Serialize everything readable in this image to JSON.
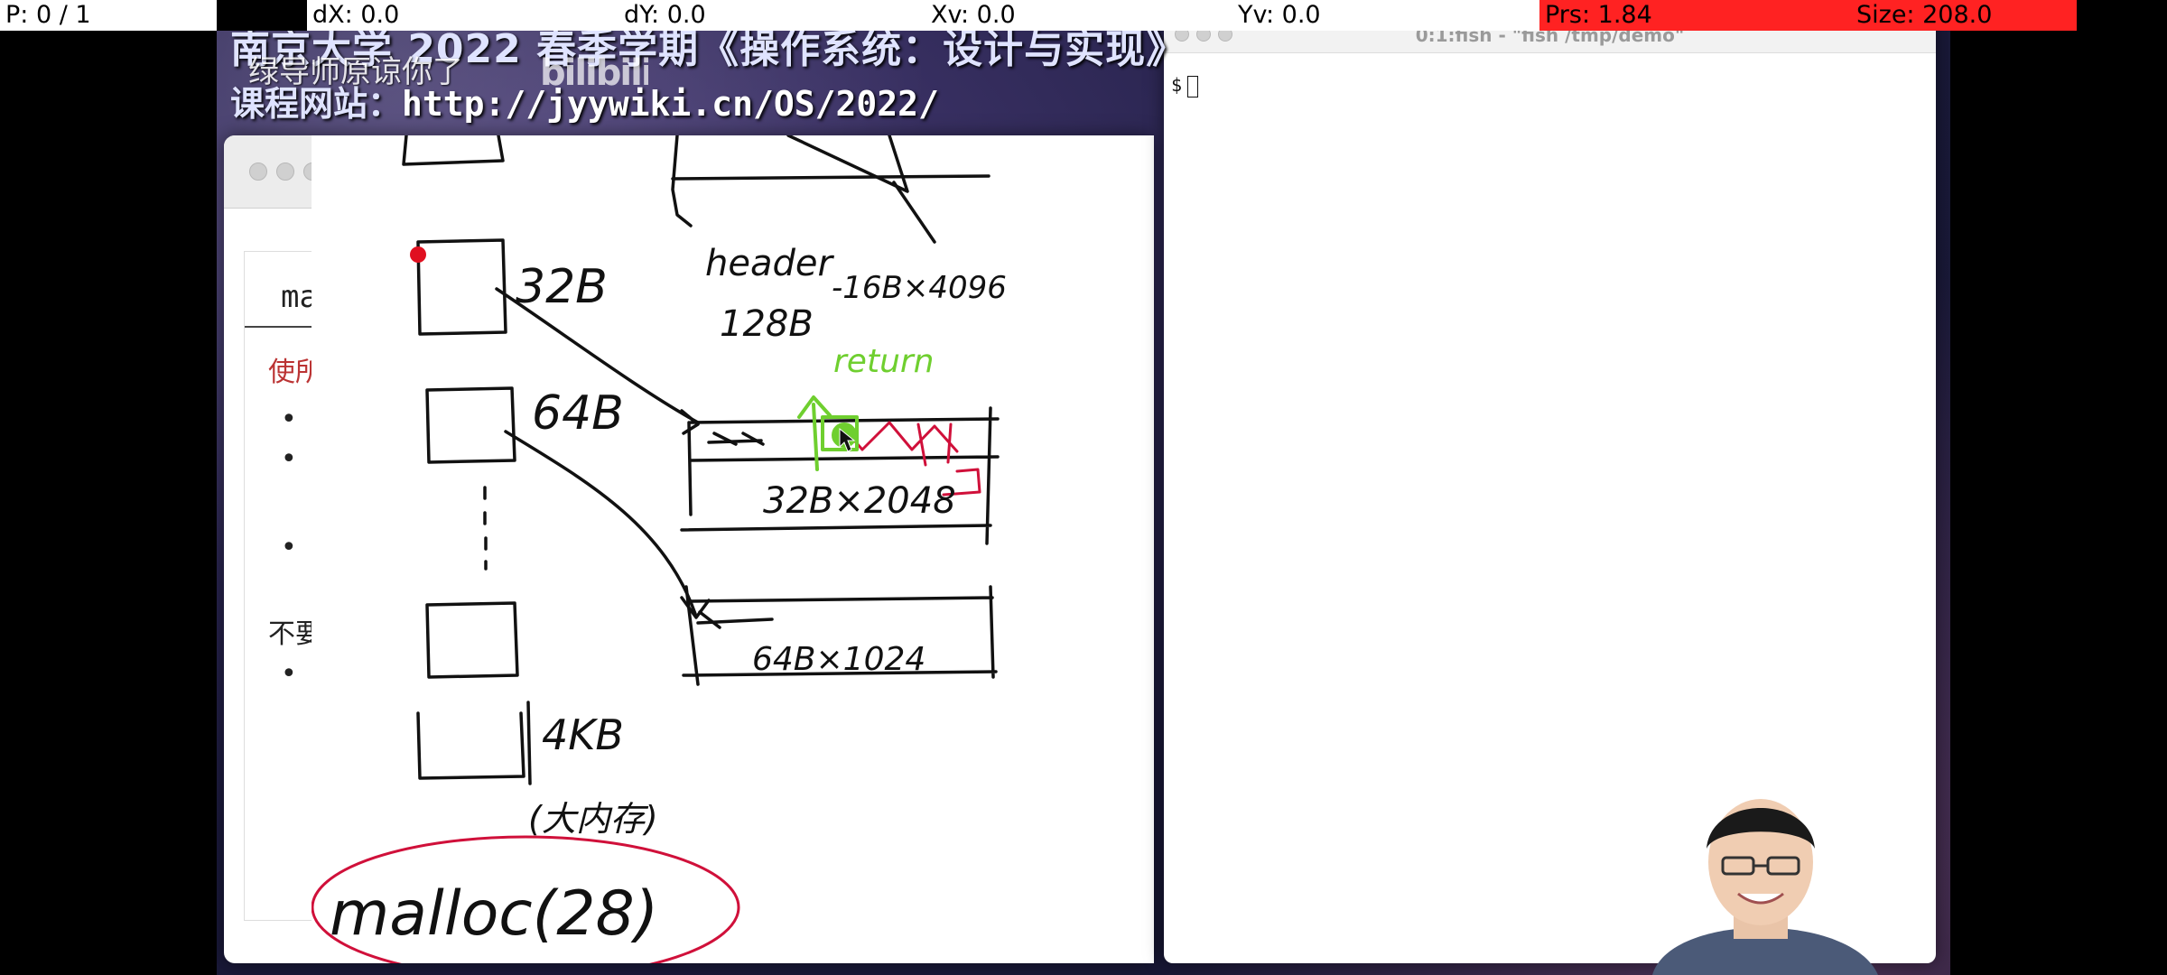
{
  "debug_bar": {
    "p": "P: 0 / 1",
    "dx": "dX: 0.0",
    "dy": "dY: 0.0",
    "xv": "Xv: 0.0",
    "yv": "Yv: 0.0",
    "prs": "Prs: 1.84",
    "size": "Size: 208.0"
  },
  "banner": {
    "line1": "南京大学 2022 春季学期《操作系统：设计与实现》",
    "line2_label": "课程网站：",
    "line2_url": "http://jyywiki.cn/OS/2022/",
    "danmu": "绿导师原谅你了",
    "watermark": "bilibili"
  },
  "browser": {
    "slide_title": "ma",
    "slide_subtitle": "使所",
    "bullets": [
      "•",
      "•",
      "•"
    ],
    "note": "不要",
    "bullet_after_note": "•"
  },
  "whiteboard": {
    "labels": {
      "b32": "32B",
      "b64": "64B",
      "b4kb": "4KB",
      "big": "(大内存)",
      "header": "header",
      "hdr128": "128B",
      "page": "-16B×4096",
      "ret": "return",
      "slab32": "32B×2048",
      "slab64": "64B×1024",
      "call": "malloc(28)"
    }
  },
  "terminal": {
    "title": "0:1:fish - \"fish /tmp/demo\"",
    "prompt": "$"
  },
  "colors": {
    "debug_bg": "#ffffff",
    "debug_red": "#ff2222",
    "ink": "#111111",
    "red_ink": "#d0103a",
    "green_ink": "#6fcf2f"
  }
}
